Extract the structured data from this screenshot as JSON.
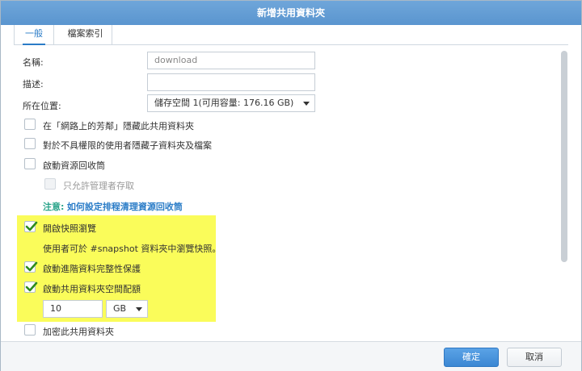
{
  "dialog": {
    "title": "新增共用資料夾",
    "tabs": [
      {
        "label": "一般",
        "active": true
      },
      {
        "label": "檔案索引",
        "active": false
      }
    ]
  },
  "form": {
    "name_label": "名稱:",
    "name_value": "download",
    "description_label": "描述:",
    "description_value": "",
    "location_label": "所在位置:",
    "location_value": "儲存空間 1(可用容量: 176.16 GB)"
  },
  "options": {
    "hide_in_network": {
      "label": "在「網路上的芳鄰」隱藏此共用資料夾",
      "checked": false
    },
    "hide_subfolders": {
      "label": "對於不具權限的使用者隱藏子資料夾及檔案",
      "checked": false
    },
    "recycle_bin": {
      "label": "啟動資源回收筒",
      "checked": false
    },
    "admin_only": {
      "label": "只允許管理者存取",
      "checked": false,
      "disabled": true
    },
    "note_prefix": "注意:",
    "note_link": "如何設定排程清理資源回收筒",
    "snapshot_browse": {
      "label": "開啟快照瀏覽",
      "checked": true
    },
    "snapshot_hint": "使用者可於 #snapshot 資料夾中瀏覽快照。",
    "data_integrity": {
      "label": "啟動進階資料完整性保護",
      "checked": true
    },
    "quota": {
      "label": "啟動共用資料夾空間配額",
      "checked": true
    },
    "quota_value": "10",
    "quota_unit": "GB",
    "encrypt": {
      "label": "加密此共用資料夾",
      "checked": false
    }
  },
  "footer": {
    "ok_label": "確定",
    "cancel_label": "取消"
  },
  "colors": {
    "accent": "#2a7cc7",
    "highlight": "#fafc5a",
    "check": "#2e8b1e"
  }
}
